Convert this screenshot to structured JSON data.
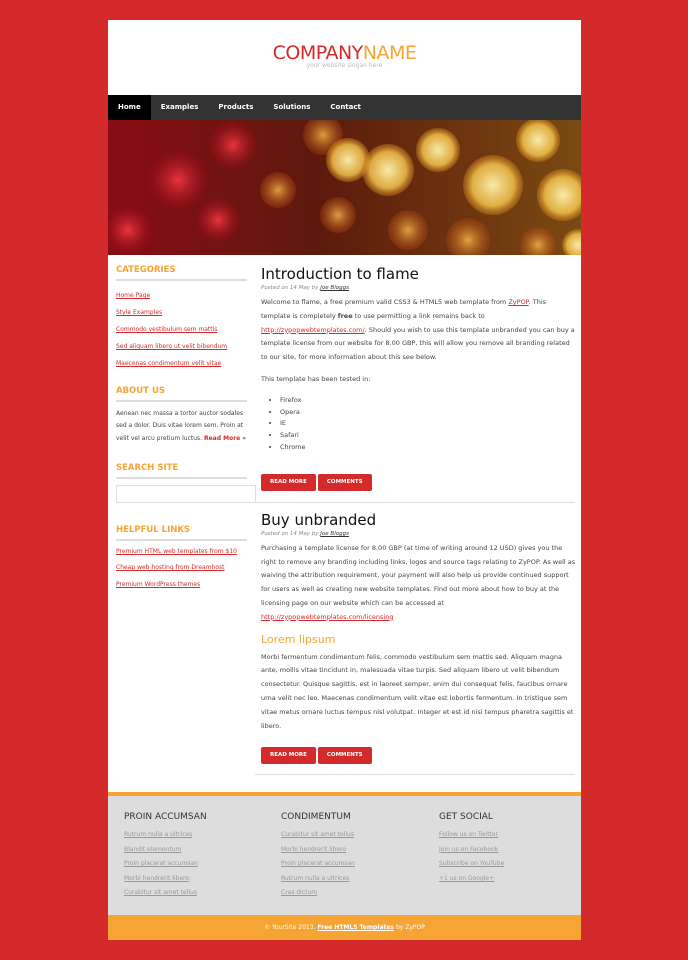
{
  "header": {
    "logo_part1": "COMPANY",
    "logo_part2": "NAME",
    "slogan": "your website slogan here"
  },
  "nav": [
    "Home",
    "Examples",
    "Products",
    "Solutions",
    "Contact"
  ],
  "sidebar": {
    "categories_title": "CATEGORIES",
    "categories": [
      "Home Page",
      "Style Examples",
      "Commodo vestibulum sem mattis",
      "Sed aliquam libero ut velit bibendum",
      "Maecenas condimentum velit vitae"
    ],
    "about_title": "ABOUT US",
    "about_text": "Aenean nec massa a tortor auctor sodales sed a dolor. Duis vitae lorem sem. Proin at velit vel arcu pretium luctus.",
    "about_more": "Read More »",
    "search_title": "SEARCH SITE",
    "links_title": "HELPFUL LINKS",
    "links": [
      "Premium HTML web templates from $10",
      "Cheap web hosting from Dreamhost",
      "Premium WordPress themes"
    ]
  },
  "post1": {
    "title": "Introduction to flame",
    "meta_prefix": "Posted on 14 May by",
    "meta_author": "Joe Bloggs",
    "p1_a": "Welcome to flame, a free premium valid CSS3 & HTML5 web template from",
    "p1_link1": "ZyPOP",
    "p1_b": ". This template is completely",
    "p1_bold": "free",
    "p1_c": "to use permitting a link remains back to",
    "p1_link2": "http://zypopwebtemplates.com/",
    "p1_d": ". Should you wish to use this template unbranded you can buy a template license from our website for 8.00 GBP, this will allow you remove all branding related to our site, for more information about this see below.",
    "p2": "This template has been tested in:",
    "browsers": [
      "Firefox",
      "Opera",
      "IE",
      "Safari",
      "Chrome"
    ],
    "read_more": "READ MORE",
    "comments": "COMMENTS"
  },
  "post2": {
    "title": "Buy unbranded",
    "meta_prefix": "Posted on 14 May by",
    "meta_author": "Joe Bloggs",
    "p1": "Purchasing a template license for 8.00 GBP (at time of writing around 12 USD) gives you the right to remove any branding including links, logos and source tags relating to ZyPOP. As well as waiving the attribution requirement, your payment will also help us provide continued support for users as well as creating new website templates. Find out more about how to buy at the licensing page on our website which can be accessed at",
    "p1_link": "http://zypopwebtemplates.com/licensing",
    "subtitle": "Lorem lipsum",
    "p2": "Morbi fermentum condimentum felis, commodo vestibulum sem mattis sed. Aliquam magna ante, mollis vitae tincidunt in, malesuada vitae turpis. Sed aliquam libero ut velit bibendum consectetur. Quisque sagittis, est in laoreet semper, enim dui consequat felis, faucibus ornare urna velit nec leo. Maecenas condimentum velit vitae est lobortis fermentum. In tristique sem vitae metus ornare luctus tempus nisl volutpat. Integer et est id nisi tempus pharetra sagittis et libero.",
    "read_more": "READ MORE",
    "comments": "COMMENTS"
  },
  "footer": {
    "col1_title": "PROIN ACCUMSAN",
    "col1": [
      "Rutrum nulla a ultrices",
      "Blandit elementum",
      "Proin placerat accumsan",
      "Morbi hendrerit libero",
      "Curabitur sit amet tellus"
    ],
    "col2_title": "CONDIMENTUM",
    "col2": [
      "Curabitur sit amet tellus",
      "Morbi hendrerit libero",
      "Proin placerat accumsan",
      "Rutrum nulla a ultrices",
      "Cras dictum"
    ],
    "col3_title": "GET SOCIAL",
    "col3": [
      "Follow us on Twitter",
      "Join us on Facebook",
      "Subscribe on YouTube",
      "+1 us on Google+"
    ],
    "copyright_a": "© YourSite 2013.",
    "copyright_link": "Free HTML5 Templates",
    "copyright_b": "by ZyPOP"
  },
  "colors": {
    "brand_red": "#d42a2b",
    "accent_orange": "#f6a433",
    "nav_bg": "#333333"
  }
}
